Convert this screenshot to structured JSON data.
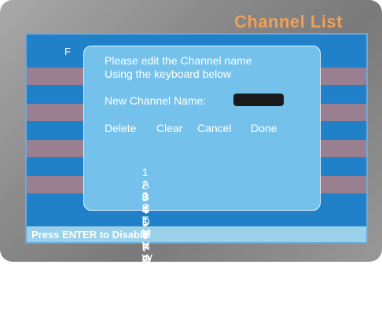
{
  "window": {
    "title": "Channel List"
  },
  "list": {
    "header_fragment": "F"
  },
  "status": {
    "hint": "Press ENTER to Disable"
  },
  "dialog": {
    "line1": "Please edit the Channel name",
    "line2": "Using the keyboard below",
    "name_label": "New Channel Name:",
    "name_value": "",
    "actions": {
      "delete": "Delete",
      "clear": "Clear",
      "cancel": "Cancel",
      "done": "Done"
    },
    "keyboard": {
      "row1": [
        "1",
        "2",
        "3",
        "4",
        "5",
        "6",
        "7",
        "8",
        "9",
        "0"
      ],
      "row2": [
        "A",
        "B",
        "C",
        "D",
        "E",
        "F",
        "G",
        "H",
        "I"
      ],
      "row3": [
        "J",
        "K",
        "L",
        "M",
        "N",
        "O",
        "P",
        "Q",
        "R"
      ],
      "row4": [
        "S",
        "T",
        "U",
        "V",
        "W",
        "X",
        "Y",
        "Z",
        "Space"
      ]
    }
  },
  "colors": {
    "title": "#f0a058",
    "screen_bg": "#2080c8",
    "dialog_bg": "#74c2ec",
    "stripe": "#9a7f90",
    "status_bar": "#9ad0e8"
  }
}
